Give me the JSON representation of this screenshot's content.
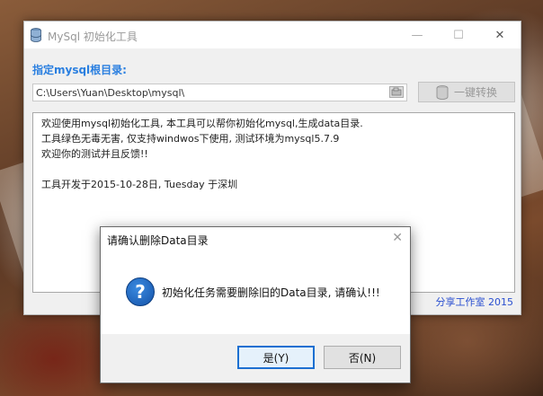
{
  "window": {
    "title": "MySql 初始化工具",
    "minimize": "—",
    "maximize": "☐",
    "close": "✕"
  },
  "form": {
    "dir_label": "指定mysql根目录:",
    "path_value": "C:\\Users\\Yuan\\Desktop\\mysql\\",
    "convert_label": "一键转换"
  },
  "info": {
    "lines": [
      "欢迎使用mysql初始化工具, 本工具可以帮你初始化mysql,生成data目录.",
      "工具绿色无毒无害, 仅支持windwos下使用, 测试环境为mysql5.7.9",
      "欢迎你的测试并且反馈!!",
      "",
      "工具开发于2015-10-28日, Tuesday 于深圳"
    ]
  },
  "footer": {
    "studio": "分享工作室 2015"
  },
  "dialog": {
    "title": "请确认删除Data目录",
    "close": "✕",
    "icon": "?",
    "message": "初始化任务需要删除旧的Data目录, 请确认!!!",
    "yes_label": "是(Y)",
    "no_label": "否(N)"
  },
  "colors": {
    "accent": "#2a7fe0",
    "studio": "#2a4fd0",
    "dialog_default_border": "#1c6fd1"
  }
}
